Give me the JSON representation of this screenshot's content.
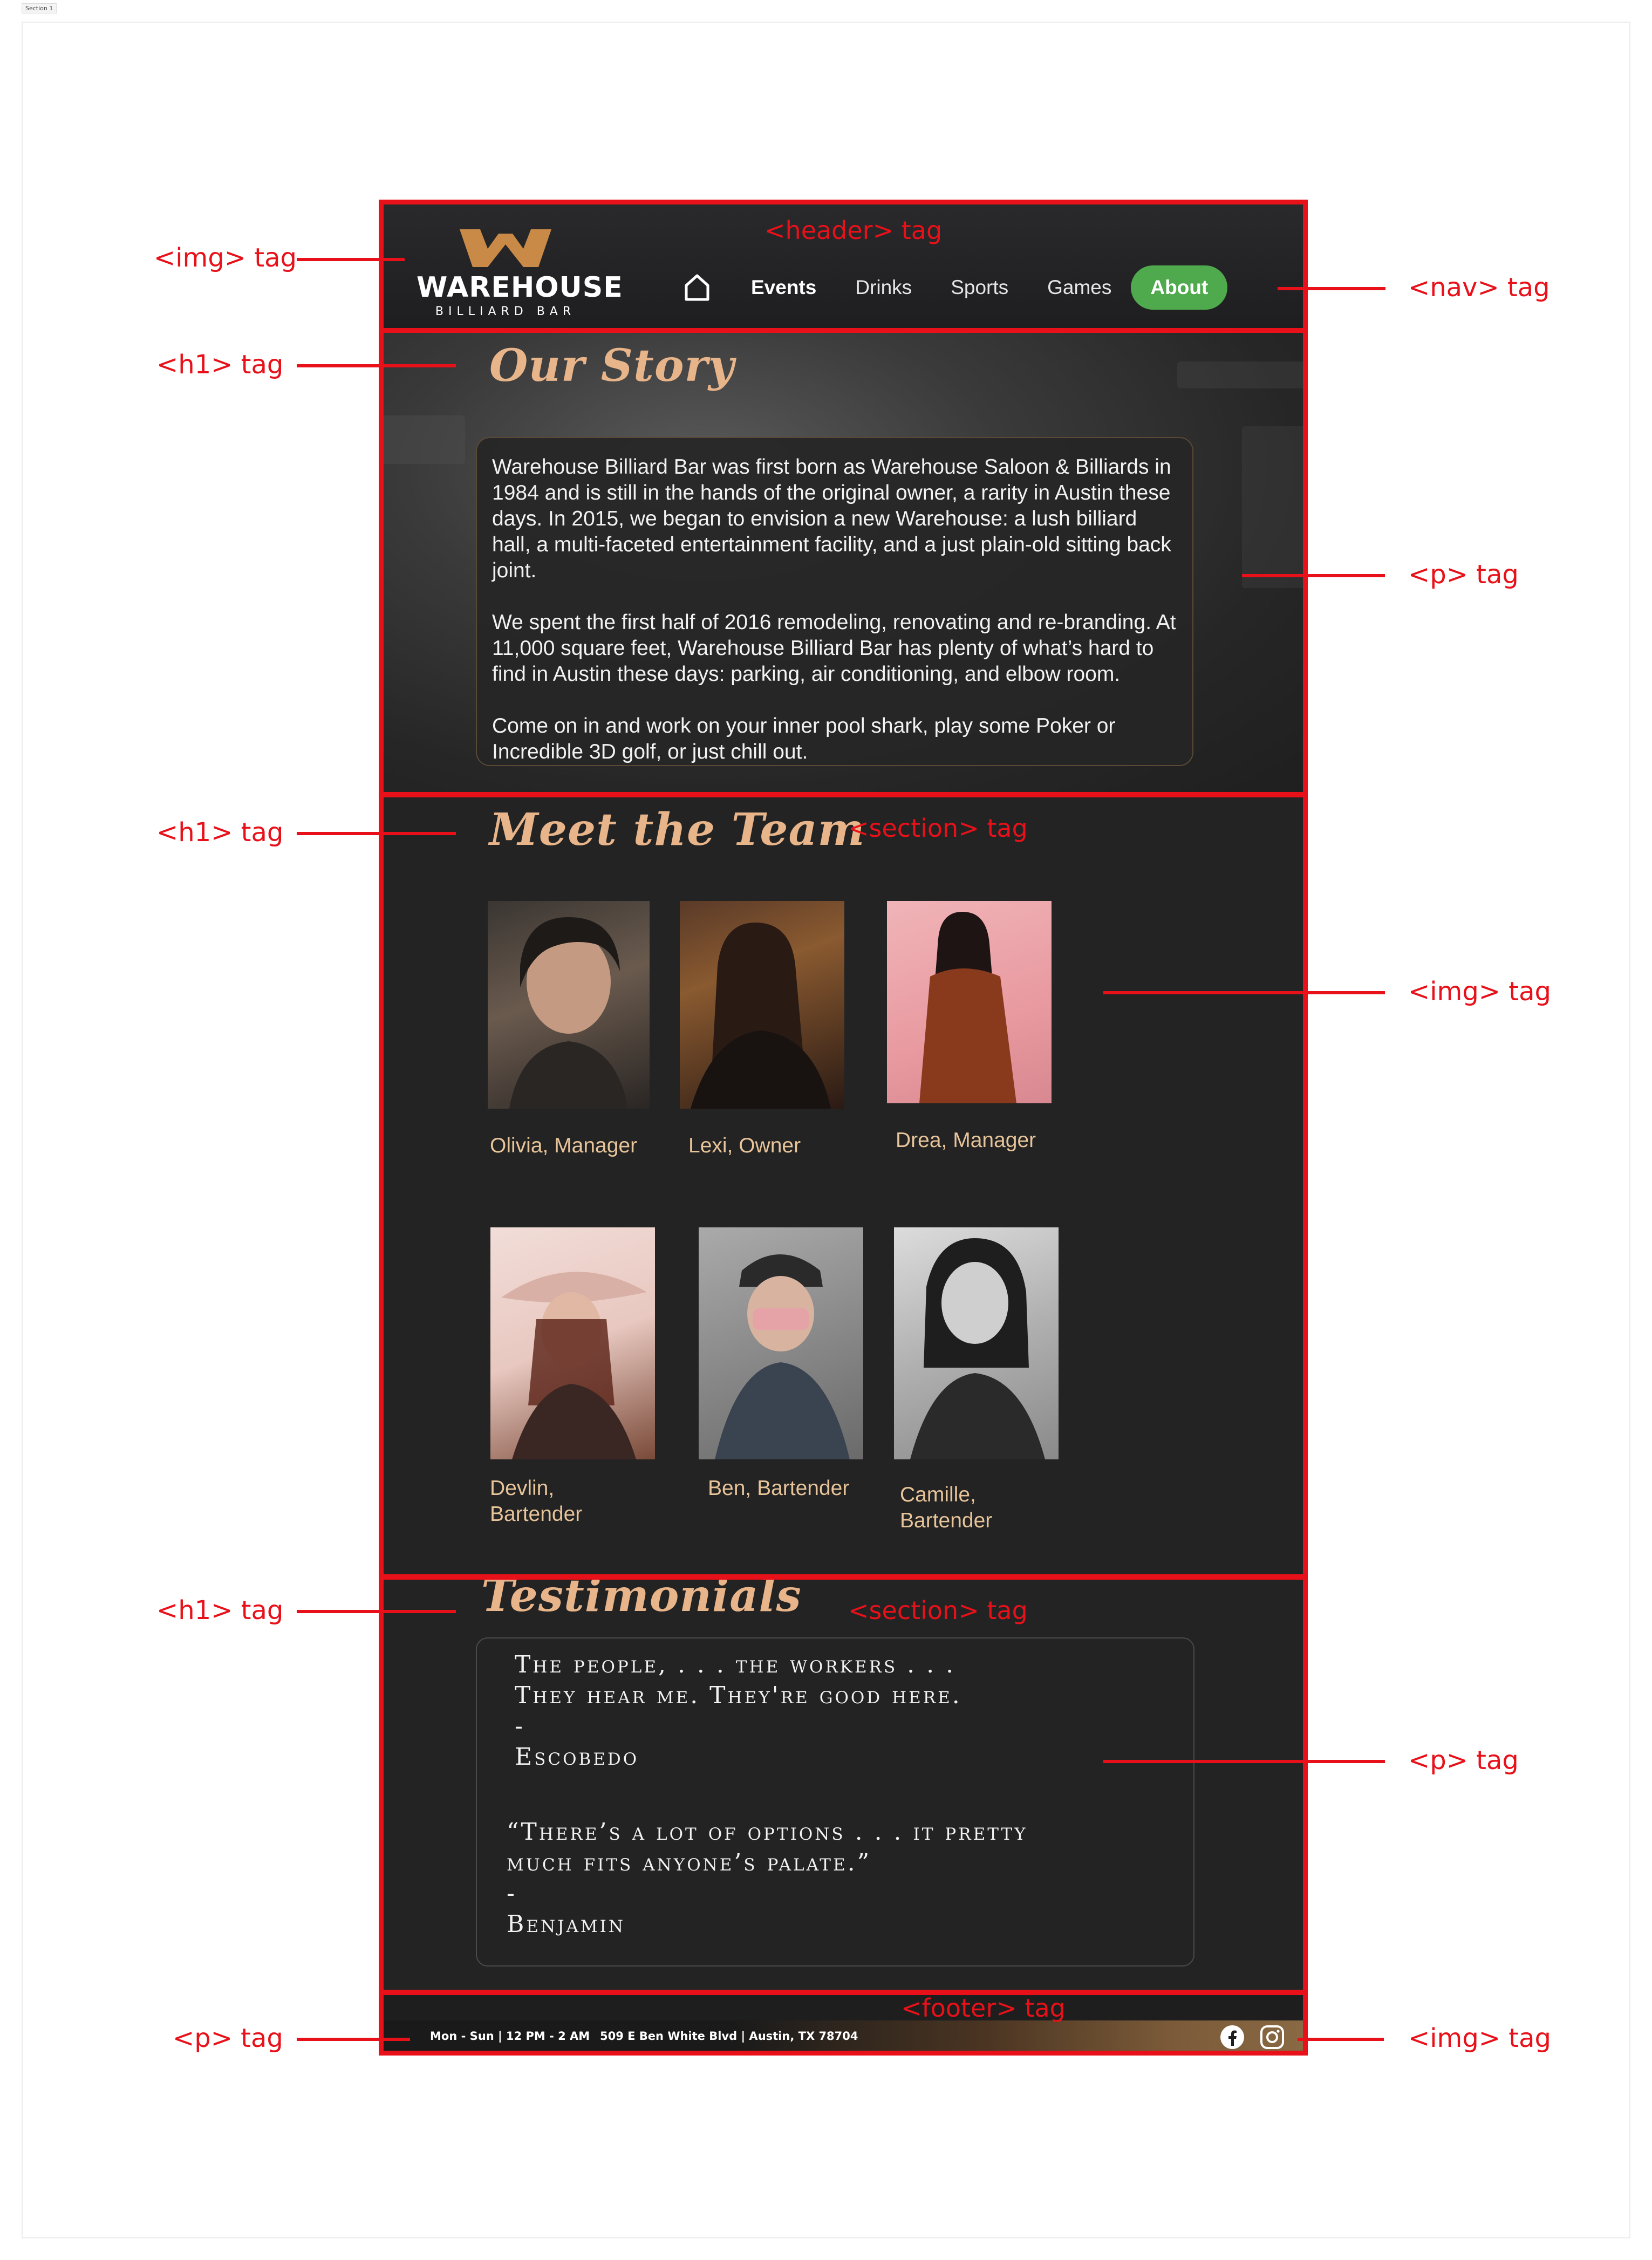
{
  "frame": {
    "label": "Section 1"
  },
  "annotations": {
    "header_tag": "<header> tag",
    "nav_tag": "<nav> tag",
    "img_tag": "<img> tag",
    "h1_tag": "<h1> tag",
    "p_tag": "<p> tag",
    "section_tag": "<section> tag",
    "footer_tag": "<footer> tag"
  },
  "header": {
    "logo_word": "WAREHOUSE",
    "logo_sub": "BILLIARD BAR",
    "nav": [
      "Events",
      "Drinks",
      "Sports",
      "Games"
    ],
    "nav_active": "About"
  },
  "story": {
    "title": "Our Story",
    "paragraphs": [
      "Warehouse Billiard Bar was first born as Warehouse Saloon & Billiards in 1984 and is still in the hands of the original owner, a rarity in Austin these days. In 2015, we began to envision a new Warehouse: a lush billiard hall, a multi-faceted entertainment facility, and a just plain-old sitting back joint.",
      "We spent the first half of 2016 remodeling, renovating and re-branding. At 11,000 square feet, Warehouse Billiard Bar has plenty of what’s hard to find in Austin these days: parking, air conditioning, and elbow room.",
      "Come on in and work on your inner pool shark, play some Poker or Incredible 3D golf, or just chill out."
    ]
  },
  "team": {
    "title": "Meet the Team",
    "members": [
      {
        "name": "Olivia, Manager"
      },
      {
        "name": "Lexi, Owner"
      },
      {
        "name": "Drea, Manager"
      },
      {
        "name": "Devlin,\nBartender"
      },
      {
        "name": "Ben, Bartender"
      },
      {
        "name": "Camille,\nBartender"
      }
    ]
  },
  "testimonials": {
    "title": "Testimonials",
    "quotes": [
      "The people, . . . the workers . . .\nThey hear me. They're good here.\n-\nEscobedo",
      "“There’s a lot of options . . . it pretty\nmuch fits anyone’s palate.”\n-\nBenjamin"
    ]
  },
  "footer": {
    "hours": "Mon - Sun | 12 PM - 2 AM",
    "address": "509 E Ben White Blvd | Austin, TX 78704",
    "social": [
      "facebook-icon",
      "instagram-icon"
    ]
  },
  "colors": {
    "accent": "#e8b48a",
    "active_nav": "#4faa4d",
    "annotation": "#e8111a",
    "background": "#222222"
  }
}
